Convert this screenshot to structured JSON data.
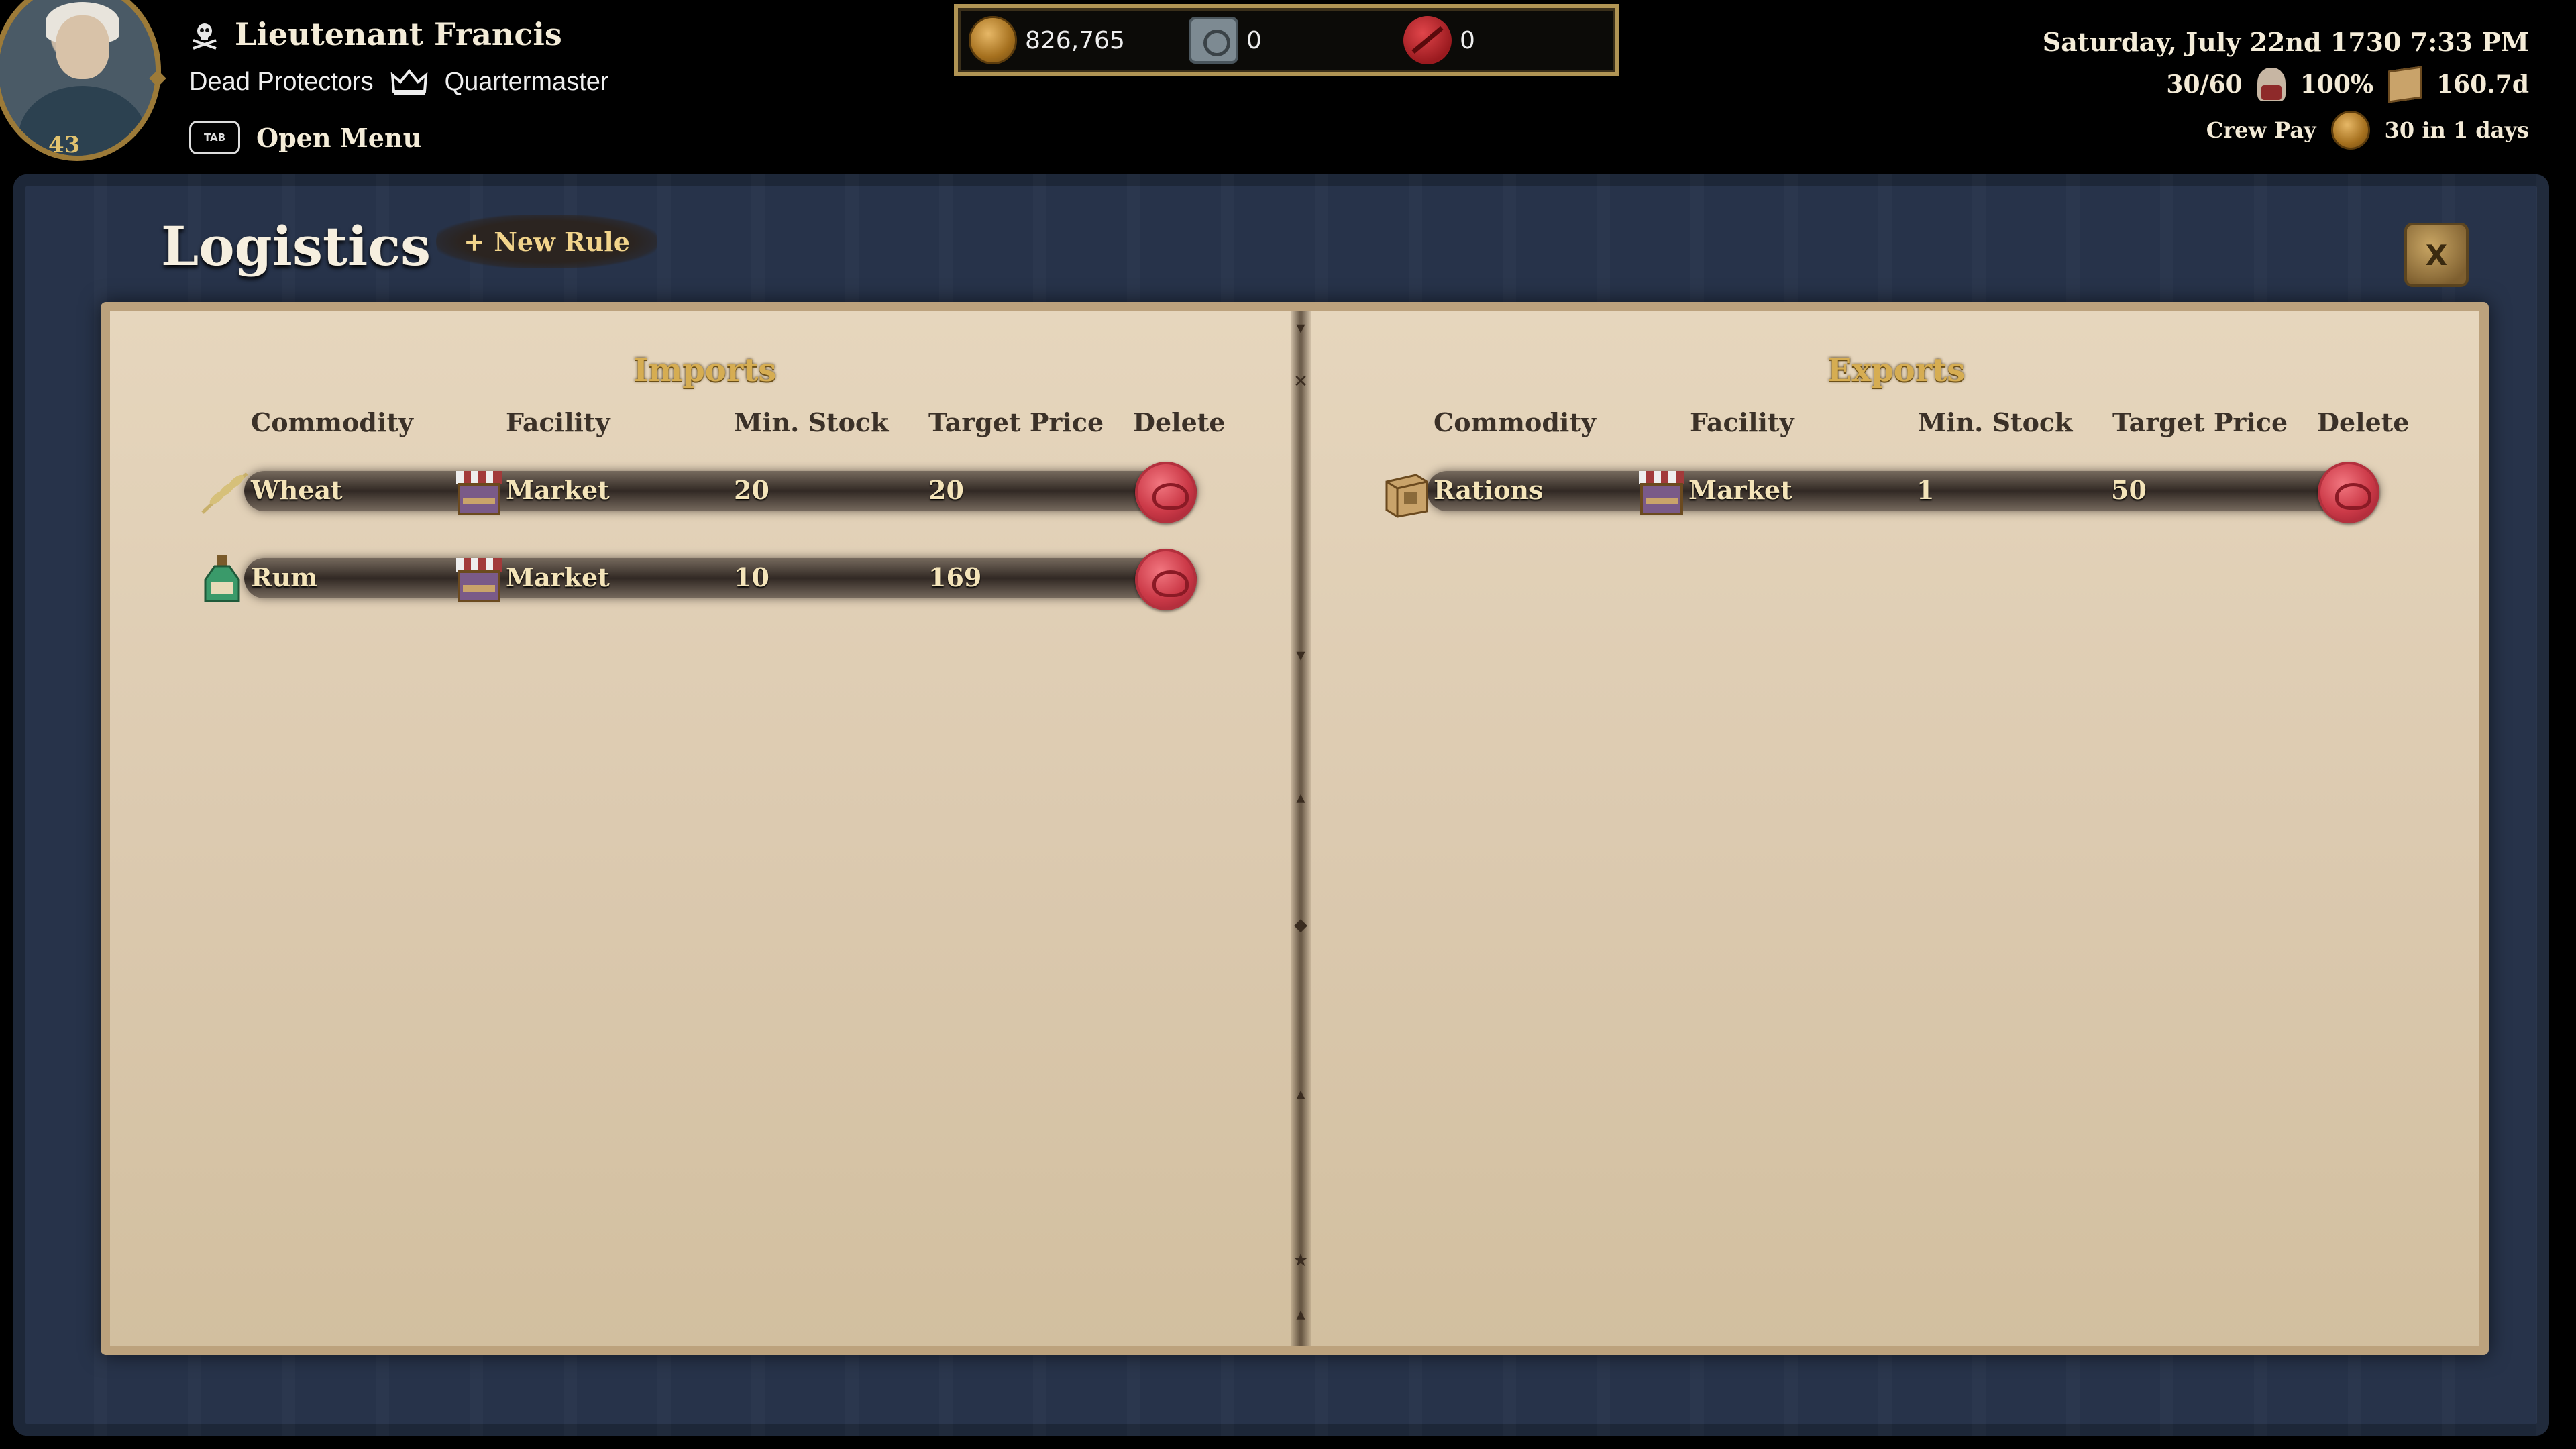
{
  "hud": {
    "level": "43",
    "captain_name": "Lieutenant Francis",
    "faction": "Dead Protectors",
    "role": "Quartermaster",
    "tab_key": "TAB",
    "open_menu": "Open Menu",
    "gold": "826,765",
    "safe": "0",
    "infamy": "0",
    "date": "Saturday, July 22nd 1730 7:33 PM",
    "crew": "30/60",
    "morale": "100%",
    "rations": "160.7d",
    "crew_pay_label": "Crew Pay",
    "crew_pay_value": "30 in 1 days"
  },
  "panel": {
    "title": "Logistics",
    "new_rule": "+ New Rule",
    "close": "X"
  },
  "imports": {
    "title": "Imports",
    "headers": {
      "commodity": "Commodity",
      "facility": "Facility",
      "min_stock": "Min. Stock",
      "target_price": "Target Price",
      "delete": "Delete"
    },
    "rows": [
      {
        "commodity": "Wheat",
        "icon": "wheat-icon",
        "facility": "Market",
        "min_stock": "20",
        "target_price": "20"
      },
      {
        "commodity": "Rum",
        "icon": "rum-bottle-icon",
        "facility": "Market",
        "min_stock": "10",
        "target_price": "169"
      }
    ]
  },
  "exports": {
    "title": "Exports",
    "headers": {
      "commodity": "Commodity",
      "facility": "Facility",
      "min_stock": "Min. Stock",
      "target_price": "Target Price",
      "delete": "Delete"
    },
    "rows": [
      {
        "commodity": "Rations",
        "icon": "rations-crate-icon",
        "facility": "Market",
        "min_stock": "1",
        "target_price": "50"
      }
    ]
  },
  "colors": {
    "panel": "#27334a",
    "parchment": "#e2d2b8",
    "gold_text": "#d6ad52",
    "seal": "#cc3a48"
  }
}
